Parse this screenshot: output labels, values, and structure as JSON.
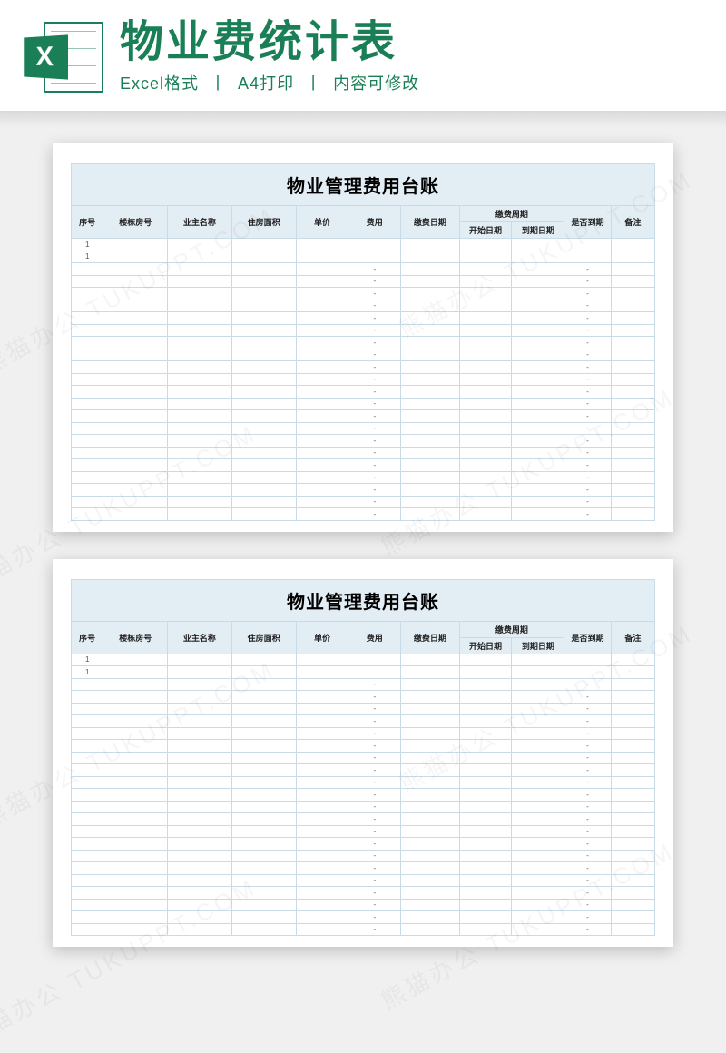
{
  "banner": {
    "icon_letter": "X",
    "title": "物业费统计表",
    "sub_parts": [
      "Excel格式",
      "A4打印",
      "内容可修改"
    ]
  },
  "sheet": {
    "title": "物业管理费用台账",
    "columns": {
      "seq": "序号",
      "room": "楼栋房号",
      "owner": "业主名称",
      "area": "住房面积",
      "price": "单价",
      "fee": "费用",
      "paydate": "缴费日期",
      "period_group": "缴费周期",
      "period_start": "开始日期",
      "period_end": "到期日期",
      "due": "是否到期",
      "note": "备注"
    },
    "rows": [
      {
        "seq": "1",
        "room": "",
        "owner": "",
        "area": "",
        "price": "",
        "fee": "",
        "paydate": "",
        "start": "",
        "end": "",
        "due": "",
        "note": ""
      },
      {
        "seq": "1",
        "room": "",
        "owner": "",
        "area": "",
        "price": "",
        "fee": "",
        "paydate": "",
        "start": "",
        "end": "",
        "due": "",
        "note": ""
      },
      {
        "seq": "",
        "room": "",
        "owner": "",
        "area": "",
        "price": "",
        "fee": "-",
        "paydate": "",
        "start": "",
        "end": "",
        "due": "-",
        "note": ""
      },
      {
        "seq": "",
        "room": "",
        "owner": "",
        "area": "",
        "price": "",
        "fee": "-",
        "paydate": "",
        "start": "",
        "end": "",
        "due": "-",
        "note": ""
      },
      {
        "seq": "",
        "room": "",
        "owner": "",
        "area": "",
        "price": "",
        "fee": "-",
        "paydate": "",
        "start": "",
        "end": "",
        "due": "-",
        "note": ""
      },
      {
        "seq": "",
        "room": "",
        "owner": "",
        "area": "",
        "price": "",
        "fee": "-",
        "paydate": "",
        "start": "",
        "end": "",
        "due": "-",
        "note": ""
      },
      {
        "seq": "",
        "room": "",
        "owner": "",
        "area": "",
        "price": "",
        "fee": "-",
        "paydate": "",
        "start": "",
        "end": "",
        "due": "-",
        "note": ""
      },
      {
        "seq": "",
        "room": "",
        "owner": "",
        "area": "",
        "price": "",
        "fee": "-",
        "paydate": "",
        "start": "",
        "end": "",
        "due": "-",
        "note": ""
      },
      {
        "seq": "",
        "room": "",
        "owner": "",
        "area": "",
        "price": "",
        "fee": "-",
        "paydate": "",
        "start": "",
        "end": "",
        "due": "-",
        "note": ""
      },
      {
        "seq": "",
        "room": "",
        "owner": "",
        "area": "",
        "price": "",
        "fee": "-",
        "paydate": "",
        "start": "",
        "end": "",
        "due": "-",
        "note": ""
      },
      {
        "seq": "",
        "room": "",
        "owner": "",
        "area": "",
        "price": "",
        "fee": "-",
        "paydate": "",
        "start": "",
        "end": "",
        "due": "-",
        "note": ""
      },
      {
        "seq": "",
        "room": "",
        "owner": "",
        "area": "",
        "price": "",
        "fee": "-",
        "paydate": "",
        "start": "",
        "end": "",
        "due": "-",
        "note": ""
      },
      {
        "seq": "",
        "room": "",
        "owner": "",
        "area": "",
        "price": "",
        "fee": "-",
        "paydate": "",
        "start": "",
        "end": "",
        "due": "-",
        "note": ""
      },
      {
        "seq": "",
        "room": "",
        "owner": "",
        "area": "",
        "price": "",
        "fee": "-",
        "paydate": "",
        "start": "",
        "end": "",
        "due": "-",
        "note": ""
      },
      {
        "seq": "",
        "room": "",
        "owner": "",
        "area": "",
        "price": "",
        "fee": "-",
        "paydate": "",
        "start": "",
        "end": "",
        "due": "-",
        "note": ""
      },
      {
        "seq": "",
        "room": "",
        "owner": "",
        "area": "",
        "price": "",
        "fee": "-",
        "paydate": "",
        "start": "",
        "end": "",
        "due": "-",
        "note": ""
      },
      {
        "seq": "",
        "room": "",
        "owner": "",
        "area": "",
        "price": "",
        "fee": "-",
        "paydate": "",
        "start": "",
        "end": "",
        "due": "-",
        "note": ""
      },
      {
        "seq": "",
        "room": "",
        "owner": "",
        "area": "",
        "price": "",
        "fee": "-",
        "paydate": "",
        "start": "",
        "end": "",
        "due": "-",
        "note": ""
      },
      {
        "seq": "",
        "room": "",
        "owner": "",
        "area": "",
        "price": "",
        "fee": "-",
        "paydate": "",
        "start": "",
        "end": "",
        "due": "-",
        "note": ""
      },
      {
        "seq": "",
        "room": "",
        "owner": "",
        "area": "",
        "price": "",
        "fee": "-",
        "paydate": "",
        "start": "",
        "end": "",
        "due": "-",
        "note": ""
      },
      {
        "seq": "",
        "room": "",
        "owner": "",
        "area": "",
        "price": "",
        "fee": "-",
        "paydate": "",
        "start": "",
        "end": "",
        "due": "-",
        "note": ""
      },
      {
        "seq": "",
        "room": "",
        "owner": "",
        "area": "",
        "price": "",
        "fee": "-",
        "paydate": "",
        "start": "",
        "end": "",
        "due": "-",
        "note": ""
      },
      {
        "seq": "",
        "room": "",
        "owner": "",
        "area": "",
        "price": "",
        "fee": "-",
        "paydate": "",
        "start": "",
        "end": "",
        "due": "-",
        "note": ""
      }
    ]
  },
  "watermark_text": "熊猫办公 TUKUPPT.COM"
}
